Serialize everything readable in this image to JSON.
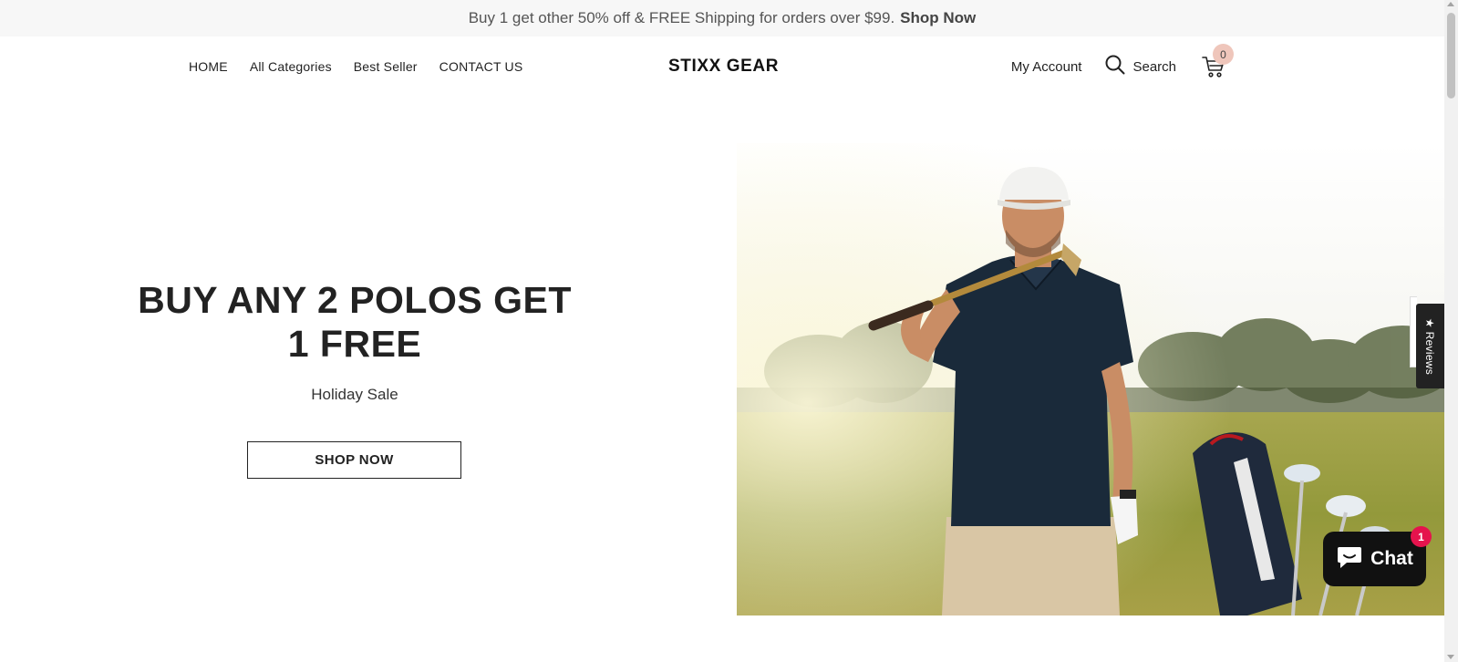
{
  "announcement": {
    "text": "Buy 1 get other 50% off & FREE Shipping for orders over $99.",
    "link": "Shop Now"
  },
  "nav": {
    "items": [
      "HOME",
      "All Categories",
      "Best Seller",
      "CONTACT US"
    ]
  },
  "logo": "STIXX GEAR",
  "header": {
    "account": "My Account",
    "search": "Search",
    "cart_count": "0",
    "icons": {
      "search": "search-icon",
      "cart": "cart-icon"
    }
  },
  "hero": {
    "title_line1": "BUY ANY 2 POLOS GET",
    "title_line2": "1 FREE",
    "subtitle": "Holiday Sale",
    "button": "SHOP NOW"
  },
  "reviews_tab": "★ Reviews",
  "chat": {
    "label": "Chat",
    "badge": "1",
    "icon": "chat-bubble-icon"
  },
  "colors": {
    "announcement_bg": "#f7f7f7",
    "cart_badge": "#efc6bb",
    "chat_badge": "#e5134d",
    "chat_bg": "#111111"
  }
}
